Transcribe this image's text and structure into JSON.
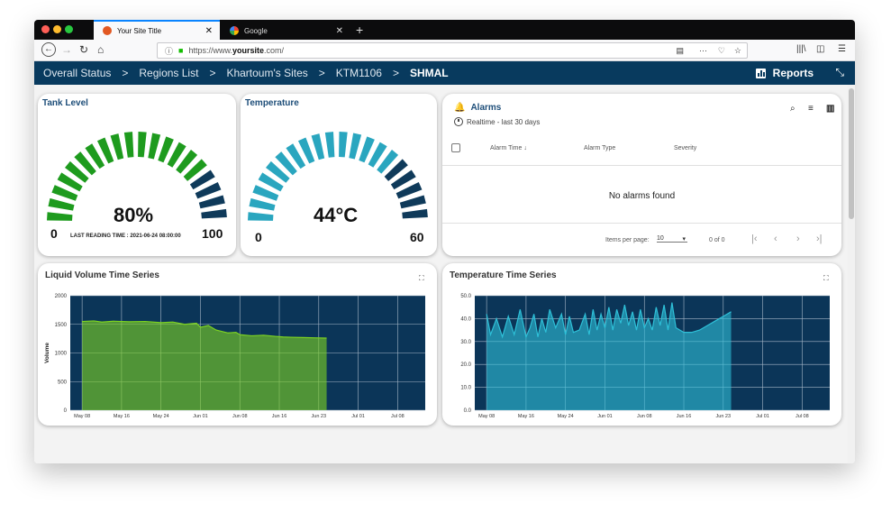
{
  "browser": {
    "tabs": [
      {
        "title": "Your Site Title",
        "active": true
      },
      {
        "title": "Google",
        "active": false
      }
    ],
    "url_prefix": "https://www.",
    "url_domain": "yoursite",
    "url_suffix": ".com/"
  },
  "breadcrumb": {
    "items": [
      "Overall Status",
      "Regions List",
      "Khartoum's Sites",
      "KTM1106",
      "SHMAL"
    ],
    "separator": ">"
  },
  "header": {
    "reports_label": "Reports"
  },
  "tank_gauge": {
    "title": "Tank Level",
    "value_text": "80%",
    "value": 80,
    "min": "0",
    "max": "100",
    "footer": "LAST READING TIME : 2021-06-24 08:00:00",
    "fill_color": "#1e9b1e",
    "rest_color": "#0f3a5a"
  },
  "temp_gauge": {
    "title": "Temperature",
    "value_text": "44°C",
    "value": 44,
    "min": "0",
    "max": "60",
    "fill_color": "#2aa6bf",
    "rest_color": "#0f3a5a"
  },
  "alarms": {
    "title": "Alarms",
    "subtitle": "Realtime - last 30 days",
    "columns": [
      "Alarm Time",
      "Alarm Type",
      "Severity"
    ],
    "sort_indicator": "↓",
    "empty_text": "No alarms found",
    "items_per_page_label": "Items per page:",
    "items_per_page": "10",
    "range_label": "0 of 0"
  },
  "chart_data": [
    {
      "type": "area",
      "title": "Liquid Volume Time Series",
      "ylabel": "Volume",
      "xlabel": "",
      "x_ticks": [
        "May 08",
        "May 16",
        "May 24",
        "Jun 01",
        "Jun 08",
        "Jun 16",
        "Jun 23",
        "Jul 01",
        "Jul 08"
      ],
      "y_ticks": [
        "0",
        "500",
        "1000",
        "1500",
        "2000"
      ],
      "ylim": [
        0,
        2000
      ],
      "series": [
        {
          "color": "#7ed321",
          "x": [
            0.0,
            0.3,
            0.5,
            0.8,
            1.2,
            1.6,
            2.0,
            2.3,
            2.6,
            2.9,
            3.0,
            3.2,
            3.4,
            3.7,
            3.9,
            4.0,
            4.3,
            4.6,
            4.9,
            5.1,
            5.3,
            5.6,
            5.9,
            6.2
          ],
          "y": [
            1550,
            1560,
            1540,
            1555,
            1545,
            1550,
            1530,
            1540,
            1500,
            1520,
            1450,
            1480,
            1400,
            1350,
            1360,
            1320,
            1300,
            1310,
            1290,
            1280,
            1275,
            1270,
            1265,
            1260
          ]
        }
      ],
      "grid": true
    },
    {
      "type": "area",
      "title": "Temperature Time Series",
      "xlabel": "",
      "ylabel": "",
      "x_ticks": [
        "May 08",
        "May 16",
        "May 24",
        "Jun 01",
        "Jun 08",
        "Jun 16",
        "Jun 23",
        "Jul 01",
        "Jul 08"
      ],
      "y_ticks": [
        "0.0",
        "10.0",
        "20.0",
        "30.0",
        "40.0",
        "50.0"
      ],
      "ylim": [
        0,
        50
      ],
      "series": [
        {
          "color": "#2ec0d8",
          "x": [
            0.0,
            0.1,
            0.25,
            0.4,
            0.55,
            0.7,
            0.85,
            1.0,
            1.1,
            1.2,
            1.3,
            1.4,
            1.5,
            1.6,
            1.75,
            1.9,
            2.0,
            2.1,
            2.2,
            2.35,
            2.5,
            2.6,
            2.7,
            2.8,
            2.9,
            3.0,
            3.1,
            3.2,
            3.3,
            3.4,
            3.5,
            3.6,
            3.7,
            3.8,
            3.9,
            4.0,
            4.1,
            4.2,
            4.3,
            4.4,
            4.5,
            4.6,
            4.7,
            4.8,
            4.9,
            5.0,
            5.2,
            5.4,
            5.6,
            5.8,
            6.0,
            6.2
          ],
          "y": [
            42,
            33,
            40,
            32,
            41,
            33,
            44,
            32,
            36,
            42,
            32,
            40,
            34,
            44,
            36,
            42,
            33,
            41,
            34,
            35,
            42,
            33,
            44,
            35,
            42,
            36,
            45,
            35,
            44,
            38,
            46,
            37,
            43,
            35,
            44,
            36,
            40,
            35,
            45,
            37,
            46,
            35,
            47,
            36,
            35,
            34,
            34,
            35,
            37,
            39,
            41,
            43
          ]
        }
      ],
      "grid": true
    }
  ]
}
